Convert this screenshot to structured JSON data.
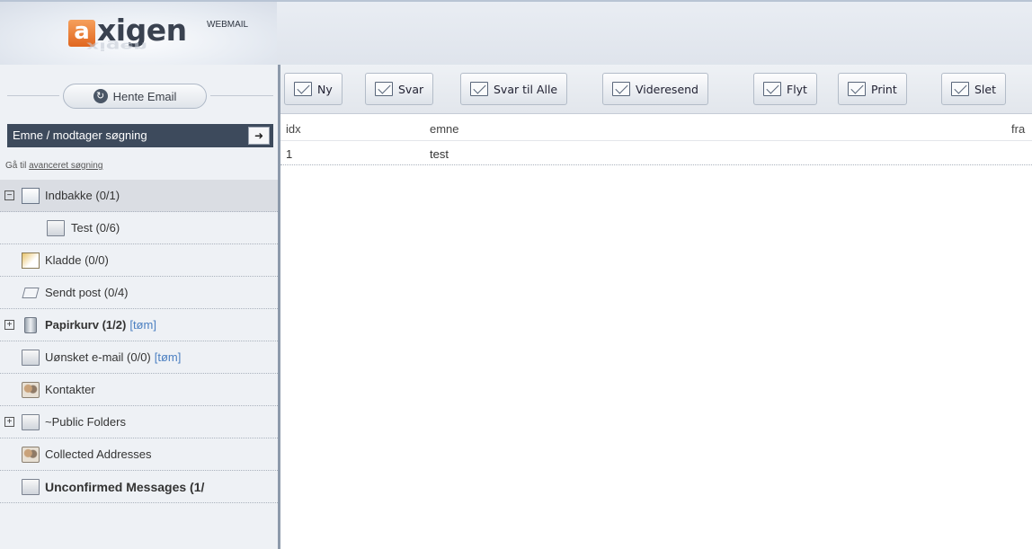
{
  "brand": {
    "logo_letter": "a",
    "logo_word": "xigen",
    "logo_sup": "WEBMAIL",
    "logo_reflection": "xigen"
  },
  "sidebar": {
    "fetch_label": "Hente Email",
    "search_placeholder": "Emne / modtager søgning",
    "advanced_prefix": "Gå til ",
    "advanced_link": "avanceret søgning",
    "folders": [
      {
        "label": "Indbakke (0/1)",
        "extra": ""
      },
      {
        "label": "Test (0/6)",
        "extra": ""
      },
      {
        "label": "Kladde (0/0)",
        "extra": ""
      },
      {
        "label": "Sendt post (0/4)",
        "extra": ""
      },
      {
        "label": "Papirkurv (1/2)",
        "extra": "[tøm]"
      },
      {
        "label": "Uønsket e-mail (0/0)",
        "extra": "[tøm]"
      },
      {
        "label": "Kontakter",
        "extra": ""
      },
      {
        "label": "~Public Folders",
        "extra": ""
      },
      {
        "label": "Collected Addresses",
        "extra": ""
      },
      {
        "label": "Unconfirmed Messages (1/",
        "extra": ""
      }
    ]
  },
  "toolbar": {
    "new": "Ny",
    "reply": "Svar",
    "reply_all": "Svar til Alle",
    "forward": "Videresend",
    "move": "Flyt",
    "print": "Print",
    "delete": "Slet"
  },
  "messages": {
    "columns": [
      "idx",
      "emne",
      "fra"
    ],
    "rows": [
      {
        "idx": "1",
        "subject": "test",
        "from": ""
      }
    ]
  },
  "colors": {
    "accent_orange": "#e0661f",
    "search_bg": "#3d4a5c",
    "link": "#4b7fc1"
  },
  "icons": {
    "fetch": "refresh-icon",
    "search": "arrow-right-icon",
    "inbox": "inbox-icon",
    "folder": "folder-icon",
    "draft": "draft-icon",
    "sent": "sent-icon",
    "trash": "trash-icon",
    "contacts": "contacts-icon"
  }
}
